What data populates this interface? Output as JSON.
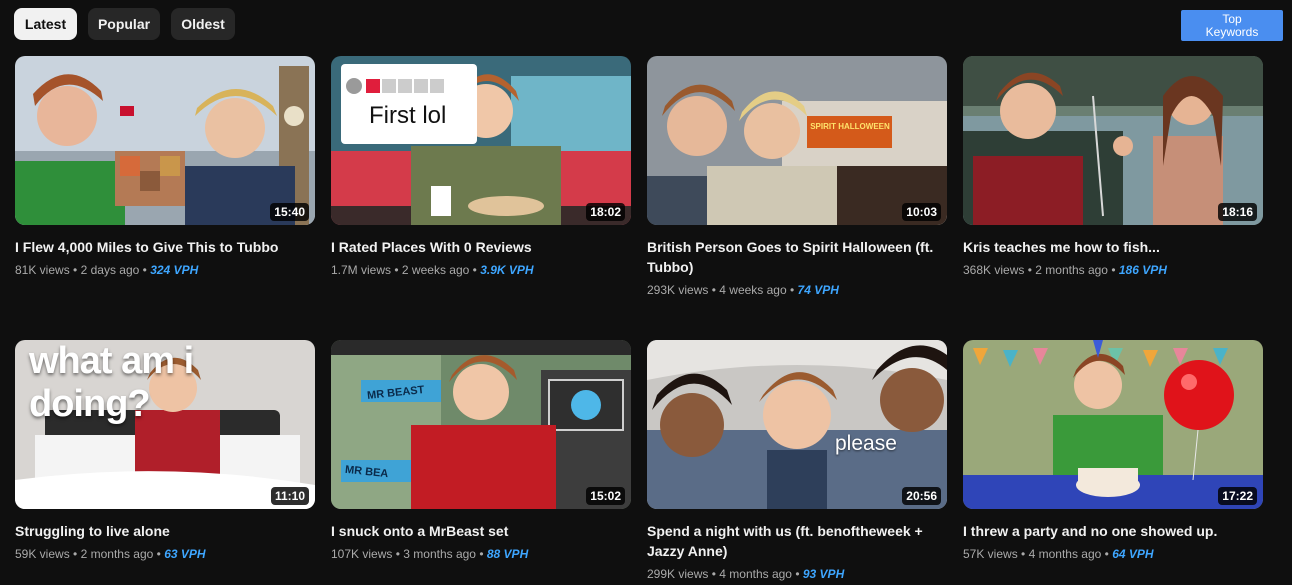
{
  "filters": {
    "latest": "Latest",
    "popular": "Popular",
    "oldest": "Oldest"
  },
  "top_keywords_button": "Top\nKeywords",
  "colors": {
    "background": "#0f0f0f",
    "vph": "#3ea6ff",
    "keywords_button": "#4a8ef0"
  },
  "videos": [
    {
      "title": "I Flew 4,000 Miles to Give This to Tubbo",
      "duration": "15:40",
      "views": "81K views",
      "age": "2 days ago",
      "vph": "324 VPH"
    },
    {
      "title": "I Rated Places With 0 Reviews",
      "duration": "18:02",
      "views": "1.7M views",
      "age": "2 weeks ago",
      "vph": "3.9K VPH",
      "thumb_text": "First lol"
    },
    {
      "title": "British Person Goes to Spirit Halloween (ft. Tubbo)",
      "duration": "10:03",
      "views": "293K views",
      "age": "4 weeks ago",
      "vph": "74 VPH",
      "thumb_text": "SPIRIT HALLOWEEN"
    },
    {
      "title": "Kris teaches me how to fish...",
      "duration": "18:16",
      "views": "368K views",
      "age": "2 months ago",
      "vph": "186 VPH"
    },
    {
      "title": "Struggling to live alone",
      "duration": "11:10",
      "views": "59K views",
      "age": "2 months ago",
      "vph": "63 VPH",
      "thumb_text": "what am i doing?"
    },
    {
      "title": "I snuck onto a MrBeast set",
      "duration": "15:02",
      "views": "107K views",
      "age": "3 months ago",
      "vph": "88 VPH",
      "thumb_text": "MR BEAST",
      "thumb_text_2": "MR BEA"
    },
    {
      "title": "Spend a night with us (ft. benoftheweek + Jazzy Anne)",
      "duration": "20:56",
      "views": "299K views",
      "age": "4 months ago",
      "vph": "93 VPH",
      "thumb_text": "please"
    },
    {
      "title": "I threw a party and no one showed up.",
      "duration": "17:22",
      "views": "57K views",
      "age": "4 months ago",
      "vph": "64 VPH"
    }
  ]
}
